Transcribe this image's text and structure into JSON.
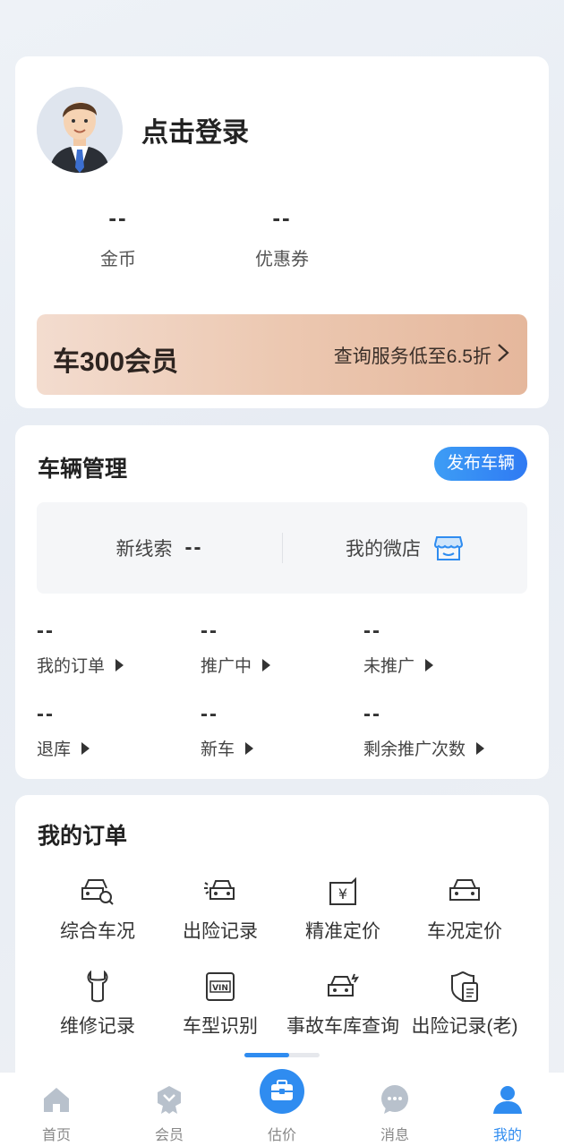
{
  "profile": {
    "login_text": "点击登录",
    "stats": [
      {
        "value": "--",
        "label": "金币"
      },
      {
        "value": "--",
        "label": "优惠券"
      }
    ],
    "vip": {
      "title": "车300会员",
      "desc": "查询服务低至6.5折"
    }
  },
  "vehicle": {
    "title": "车辆管理",
    "publish_label": "发布车辆",
    "leads": {
      "label": "新线索",
      "value": "--"
    },
    "shop": {
      "label": "我的微店",
      "icon": "shop-icon"
    },
    "stats": [
      {
        "value": "--",
        "label": "我的订单"
      },
      {
        "value": "--",
        "label": "推广中"
      },
      {
        "value": "--",
        "label": "未推广"
      },
      {
        "value": "--",
        "label": "退库"
      },
      {
        "value": "--",
        "label": "新车"
      },
      {
        "value": "--",
        "label": "剩余推广次数"
      }
    ]
  },
  "orders": {
    "title": "我的订单",
    "services": [
      {
        "label": "综合车况",
        "icon": "car-search-icon"
      },
      {
        "label": "出险记录",
        "icon": "car-crash-icon"
      },
      {
        "label": "精准定价",
        "icon": "price-tag-icon"
      },
      {
        "label": "车况定价",
        "icon": "car-icon"
      },
      {
        "label": "维修记录",
        "icon": "wrench-icon"
      },
      {
        "label": "车型识别",
        "icon": "vin-icon"
      },
      {
        "label": "事故车库查询",
        "icon": "car-accident-icon"
      },
      {
        "label": "出险记录(老)",
        "icon": "document-shield-icon"
      }
    ]
  },
  "tabbar": {
    "tabs": [
      {
        "label": "首页",
        "icon": "home-icon"
      },
      {
        "label": "会员",
        "icon": "member-badge-icon"
      },
      {
        "label": "估价",
        "icon": "briefcase-icon"
      },
      {
        "label": "消息",
        "icon": "chat-icon"
      },
      {
        "label": "我的",
        "icon": "user-icon"
      }
    ],
    "active_index": 4
  },
  "colors": {
    "accent": "#2f8cf0",
    "vip_gradient_start": "#f3dccf",
    "vip_gradient_end": "#e5b79c"
  }
}
